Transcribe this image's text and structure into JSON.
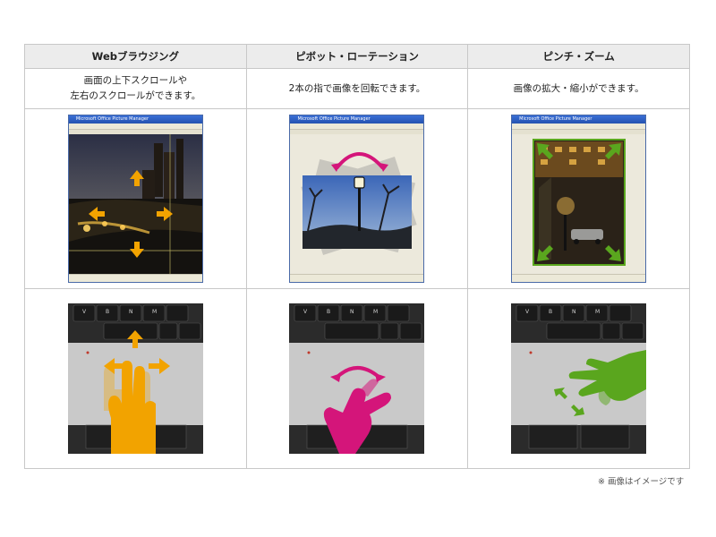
{
  "columns": [
    {
      "header": "Webブラウジング",
      "desc_line1": "画面の上下スクロールや",
      "desc_line2": "左右のスクロールができます。"
    },
    {
      "header": "ピボット・ローテーション",
      "desc_line1": "2本の指で画像を回転できます。",
      "desc_line2": ""
    },
    {
      "header": "ピンチ・ズーム",
      "desc_line1": "画像の拡大・縮小ができます。",
      "desc_line2": ""
    }
  ],
  "window_title": "Microsoft Office Picture Manager",
  "key_labels": {
    "v": "V",
    "b": "B",
    "n": "N",
    "m": "M"
  },
  "footnote": "※ 画像はイメージです",
  "colors": {
    "scroll": "#f2a300",
    "rotate": "#d4157a",
    "zoom": "#5aa61e"
  }
}
